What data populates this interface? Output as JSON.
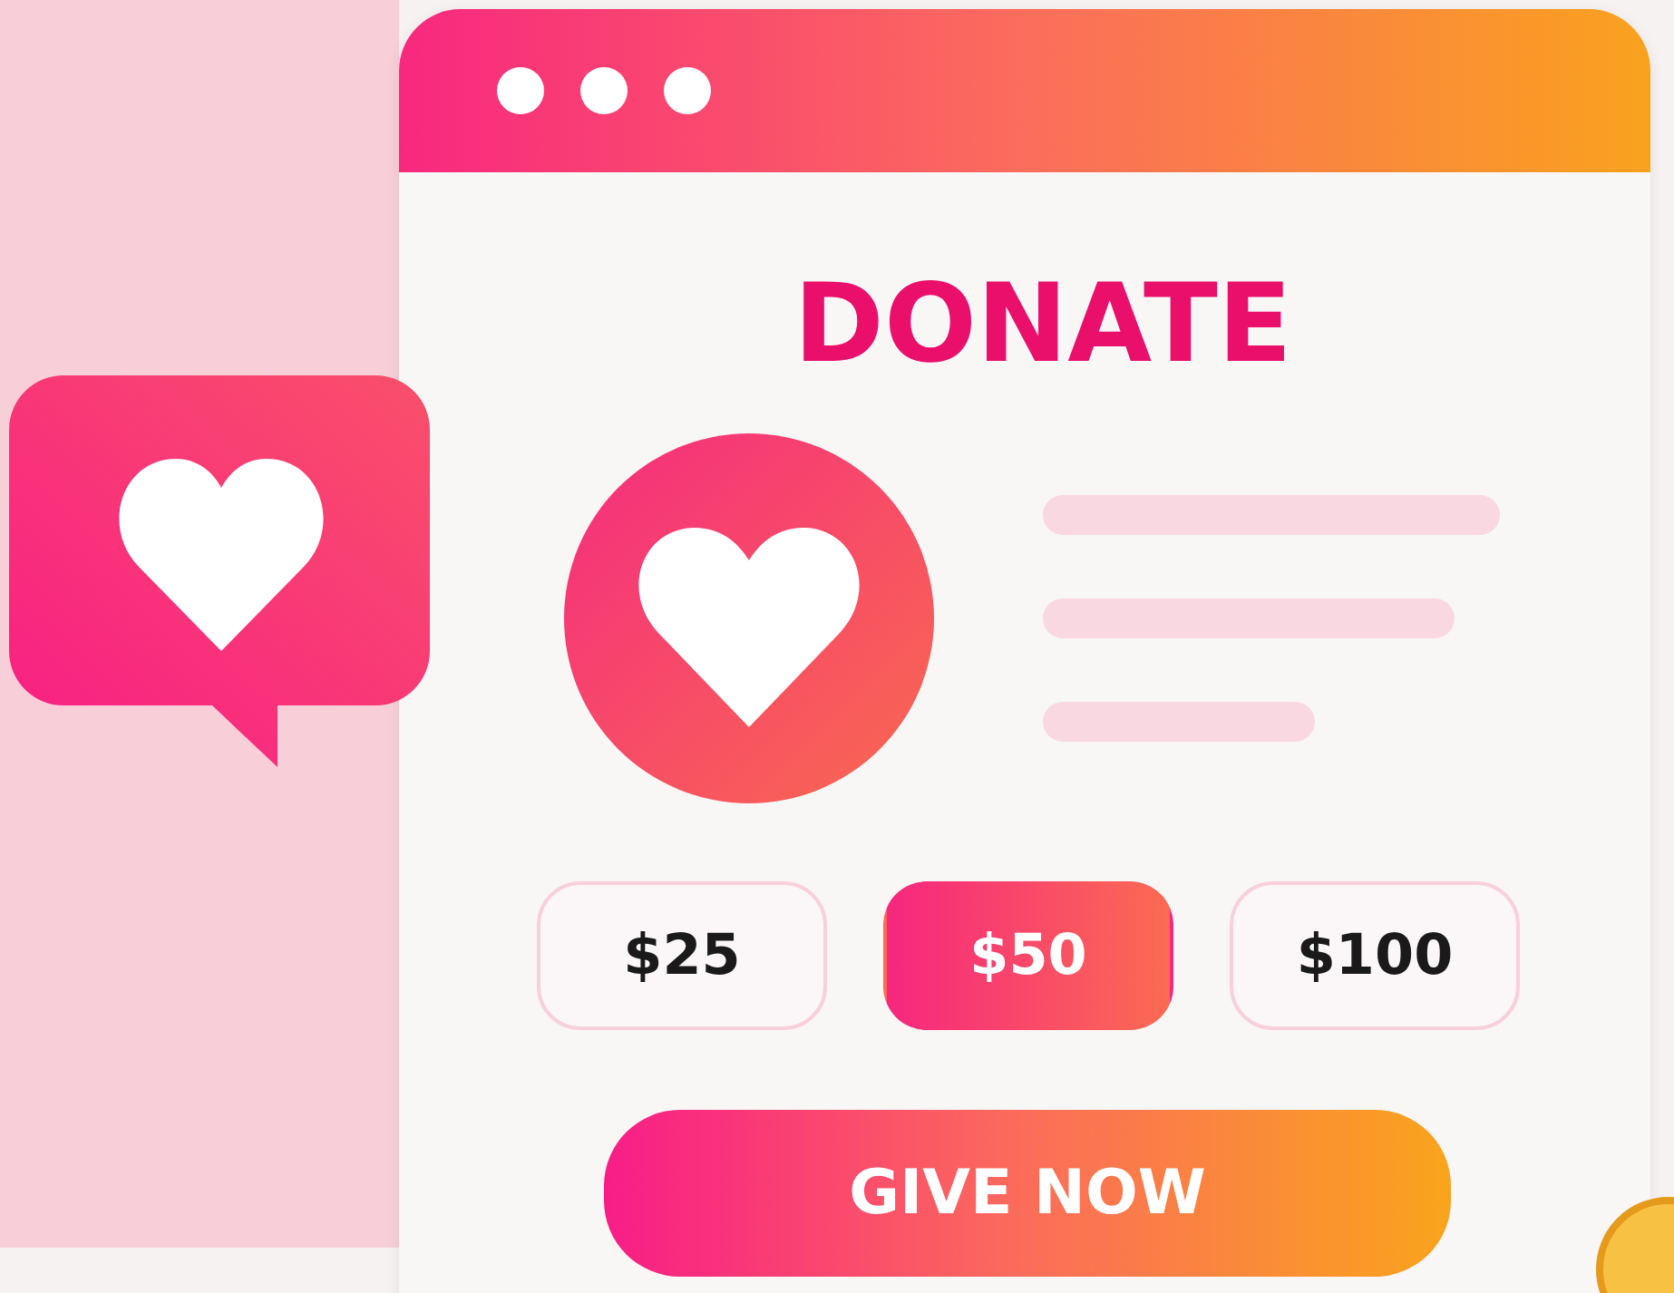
{
  "title": "DONATE",
  "amounts": [
    {
      "label": "$25",
      "selected": false
    },
    {
      "label": "$50",
      "selected": true
    },
    {
      "label": "$100",
      "selected": false
    }
  ],
  "action": "GIVE NOW"
}
